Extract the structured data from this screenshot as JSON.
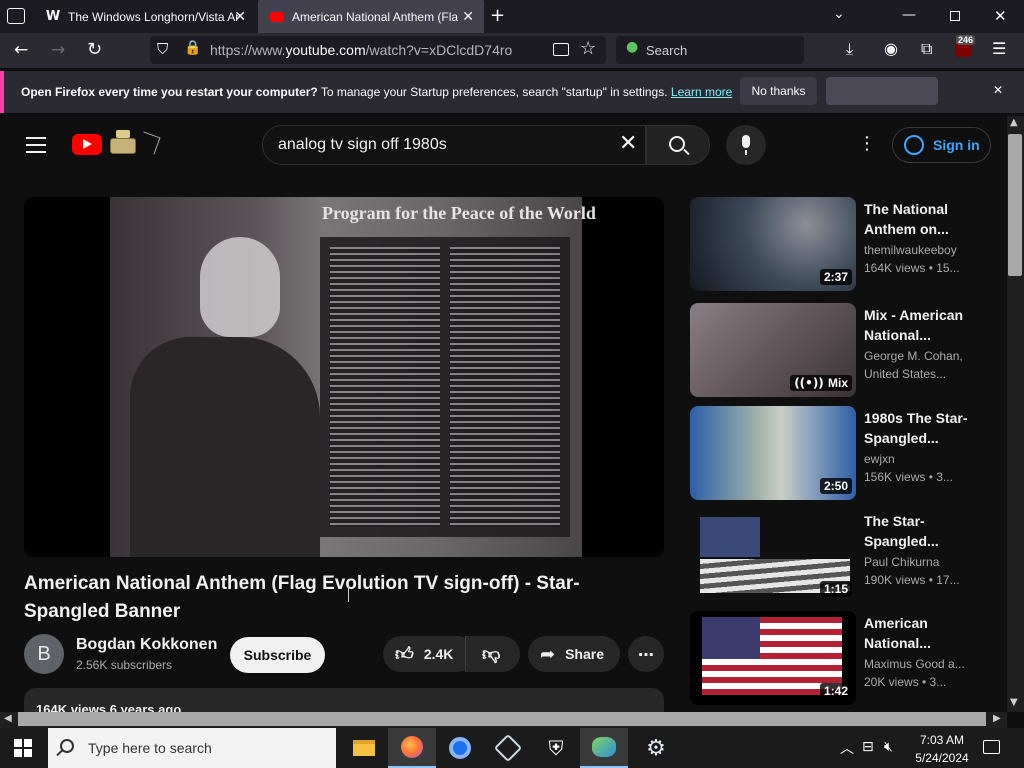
{
  "browser": {
    "tabs": [
      {
        "label": "The Windows Longhorn/Vista Ar",
        "active": false
      },
      {
        "label": "American National Anthem (Fla",
        "active": true
      }
    ],
    "url_prefix": "https://www.",
    "url_domain": "youtube.com",
    "url_rest": "/watch?v=xDClcdD74ro",
    "search_placeholder": "Search",
    "extension_badge": "246"
  },
  "notification": {
    "bold_text": "Open Firefox every time you restart your computer?",
    "text": " To manage your Startup preferences, search \"startup\" in settings.",
    "link": "Learn more",
    "no_thanks": "No thanks"
  },
  "youtube": {
    "search_query": "analog tv sign off 1980s",
    "sign_in": "Sign in",
    "video_title": "American National Anthem (Flag Evolution TV sign-off) - Star-Spangled Banner",
    "channel": {
      "avatar_letter": "B",
      "name": "Bogdan Kokkonen",
      "subscribers": "2.56K subscribers"
    },
    "subscribe": "Subscribe",
    "likes": "2.4K",
    "share": "Share",
    "description_preview": "164K views  6 years ago",
    "video_frame_heading": "Program for the Peace of the World",
    "recommendations": [
      {
        "title": "The National Anthem on...",
        "channel": "themilwaukeeboy",
        "meta": "164K views  • 15...",
        "duration": "2:37",
        "thumb_color": "#3d4a5a"
      },
      {
        "title": "Mix - American National...",
        "channel": "George M. Cohan,",
        "meta": "United States...",
        "duration": "Mix",
        "thumb_color": "#6a5f63"
      },
      {
        "title": "1980s The Star-Spangled...",
        "channel": "ewjxn",
        "meta": "156K views  • 3...",
        "duration": "2:50",
        "thumb_color": "#2d5fa8"
      },
      {
        "title": "The Star-Spangled...",
        "channel": "Paul Chikurna",
        "meta": "190K views  • 17...",
        "duration": "1:15",
        "thumb_color": "#6d8fb5"
      },
      {
        "title": "American National...",
        "channel": "Maximus Good a...",
        "meta": "20K views  • 3...",
        "duration": "1:42",
        "thumb_color": "#b22234"
      }
    ]
  },
  "taskbar": {
    "search_placeholder": "Type here to search",
    "time": "7:03 AM",
    "date": "5/24/2024"
  },
  "colors": {
    "accent_pink": "#ff3fa4",
    "youtube_red": "#ff0000",
    "link_blue": "#3ea6ff"
  }
}
